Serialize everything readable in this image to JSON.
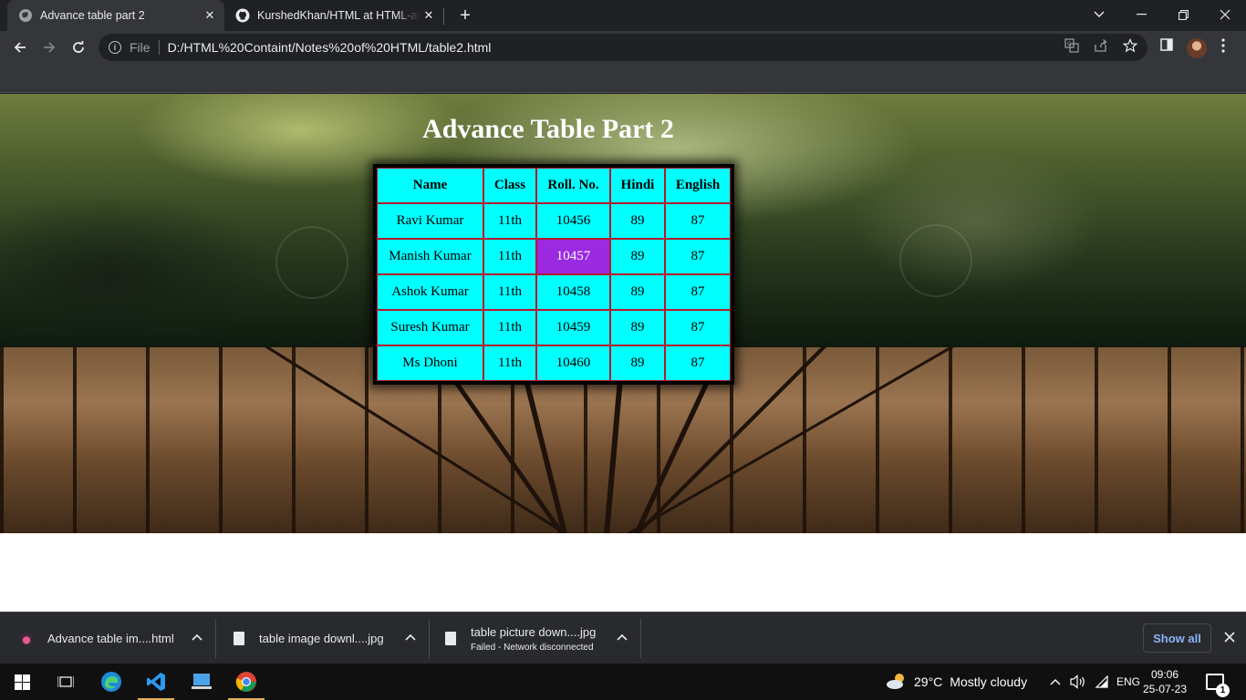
{
  "browser": {
    "tabs": [
      {
        "title": "Advance table part 2",
        "active": true,
        "icon": "globe-icon"
      },
      {
        "title": "KurshedKhan/HTML at HTML-and",
        "active": false,
        "icon": "github-icon"
      }
    ],
    "new_tab_label": "+",
    "omnibox": {
      "scheme_label": "File",
      "url": "D:/HTML%20Containt/Notes%20of%20HTML/table2.html"
    }
  },
  "page": {
    "heading": "Advance Table Part 2",
    "table": {
      "headers": [
        "Name",
        "Class",
        "Roll. No.",
        "Hindi",
        "English"
      ],
      "rows": [
        [
          "Ravi Kumar",
          "11th",
          "10456",
          "89",
          "87"
        ],
        [
          "Manish Kumar",
          "11th",
          "10457",
          "89",
          "87"
        ],
        [
          "Ashok Kumar",
          "11th",
          "10458",
          "89",
          "87"
        ],
        [
          "Suresh Kumar",
          "11th",
          "10459",
          "89",
          "87"
        ],
        [
          "Ms Dhoni",
          "11th",
          "10460",
          "89",
          "87"
        ]
      ],
      "highlight_color": "#9b2ae0",
      "cell_color": "#00ffff"
    }
  },
  "downloads": {
    "items": [
      {
        "name": "Advance table im....html",
        "status": ""
      },
      {
        "name": "table image downl....jpg",
        "status": ""
      },
      {
        "name": "table picture down....jpg",
        "status": "Failed - Network disconnected"
      }
    ],
    "show_all_label": "Show all"
  },
  "taskbar": {
    "weather": {
      "temp": "29°C",
      "condition": "Mostly cloudy"
    },
    "language": "ENG",
    "time": "09:06",
    "date": "25-07-23",
    "notification_count": "1"
  }
}
